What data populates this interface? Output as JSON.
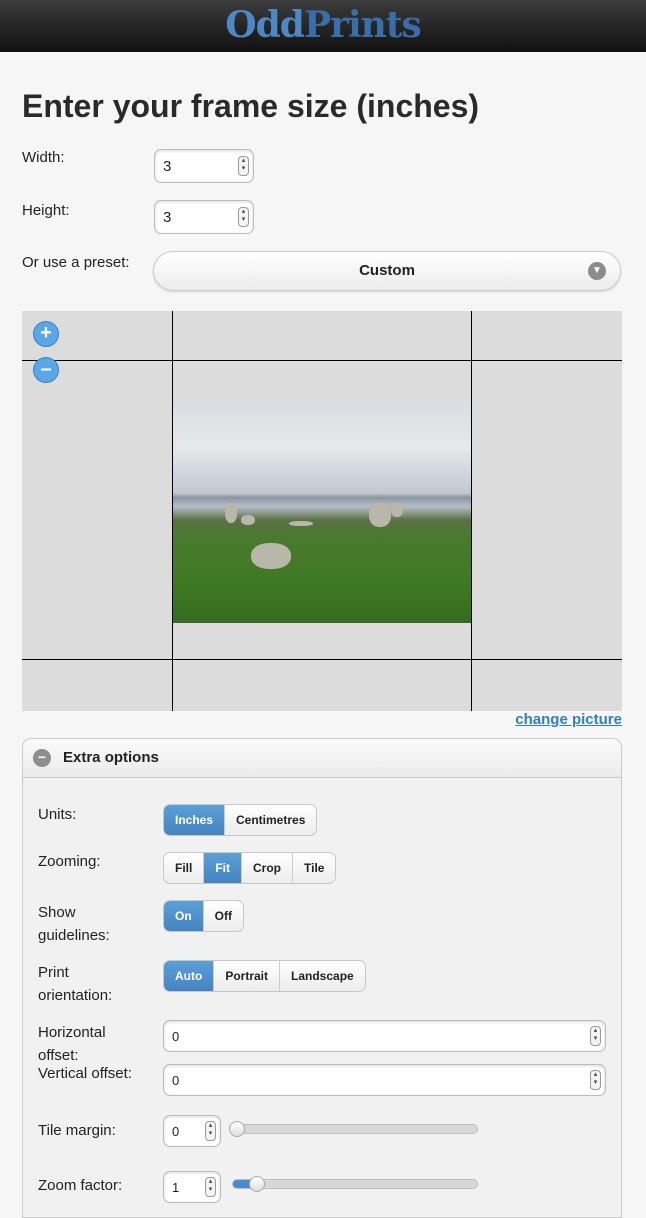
{
  "header": {
    "brand_part1": "Odd",
    "brand_part2": "Prints"
  },
  "page_title": "Enter your frame size (inches)",
  "width_label": "Width:",
  "width_value": "3",
  "height_label": "Height:",
  "height_value": "3",
  "preset_label": "Or use a preset:",
  "preset_value": "Custom",
  "zoom_in": "+",
  "zoom_out": "–",
  "change_picture": "change picture",
  "extra": {
    "title": "Extra options",
    "units_label": "Units:",
    "units_options": [
      "Inches",
      "Centimetres"
    ],
    "zooming_label": "Zooming:",
    "zooming_options": [
      "Fill",
      "Fit",
      "Crop",
      "Tile"
    ],
    "guidelines_label": "Show guidelines:",
    "guidelines_options": [
      "On",
      "Off"
    ],
    "orientation_label": "Print orientation:",
    "orientation_options": [
      "Auto",
      "Portrait",
      "Landscape"
    ],
    "hoffset_label": "Horizontal offset:",
    "hoffset_value": "0",
    "voffset_label": "Vertical offset:",
    "voffset_value": "0",
    "tile_margin_label": "Tile margin:",
    "tile_margin_value": "0",
    "tile_margin_level": 0,
    "zoom_factor_label": "Zoom factor:",
    "zoom_factor_value": "1",
    "zoom_factor_level": 0.08
  },
  "colors": {
    "accent": "#4a8ccb",
    "link": "#2f7fc3"
  }
}
